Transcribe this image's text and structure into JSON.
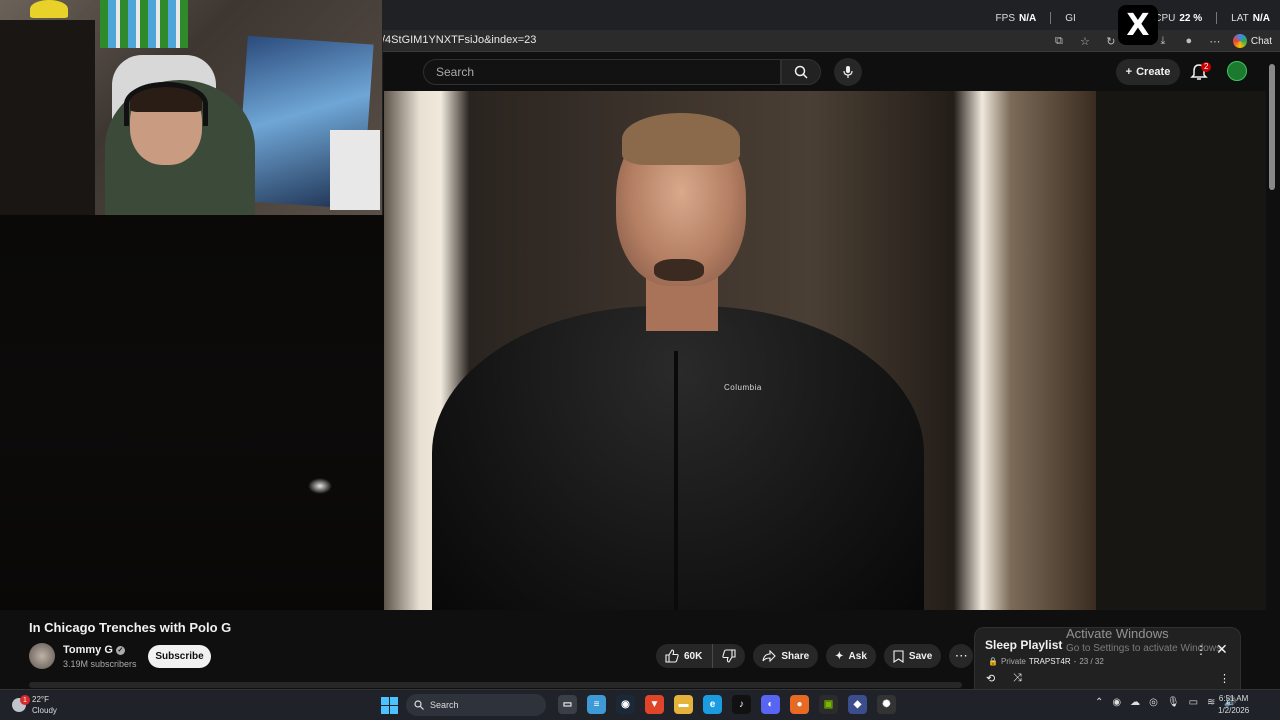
{
  "browser": {
    "url": "/4StGIM1YNXTFsiJo&index=23",
    "chat_label": "Chat"
  },
  "overlay_stats": {
    "fps_label": "FPS",
    "fps_value": "N/A",
    "gpu_label": "GI",
    "cpu_label": "CPU",
    "cpu_value": "22 %",
    "lat_label": "LAT",
    "lat_value": "N/A",
    "x_logo": "X"
  },
  "youtube_header": {
    "search_placeholder": "Search",
    "create_label": "Create",
    "notification_count": "2"
  },
  "video": {
    "jacket_brand": "Columbia",
    "title": "In Chicago Trenches with Polo G",
    "channel": "Tommy G",
    "subscribers": "3.19M subscribers",
    "subscribe_label": "Subscribe",
    "likes": "60K",
    "share_label": "Share",
    "ask_label": "Ask",
    "save_label": "Save"
  },
  "playlist": {
    "title": "Sleep Playlist",
    "privacy": "Private",
    "owner": "TRAPST4R",
    "position": "23 / 32"
  },
  "watermark": {
    "title": "Activate Windows",
    "subtitle": "Go to Settings to activate Windows."
  },
  "taskbar": {
    "weather_temp": "22°F",
    "weather_desc": "Cloudy",
    "weather_badge": "1",
    "search_label": "Search",
    "time": "6:51 AM",
    "date": "1/2/2026"
  }
}
